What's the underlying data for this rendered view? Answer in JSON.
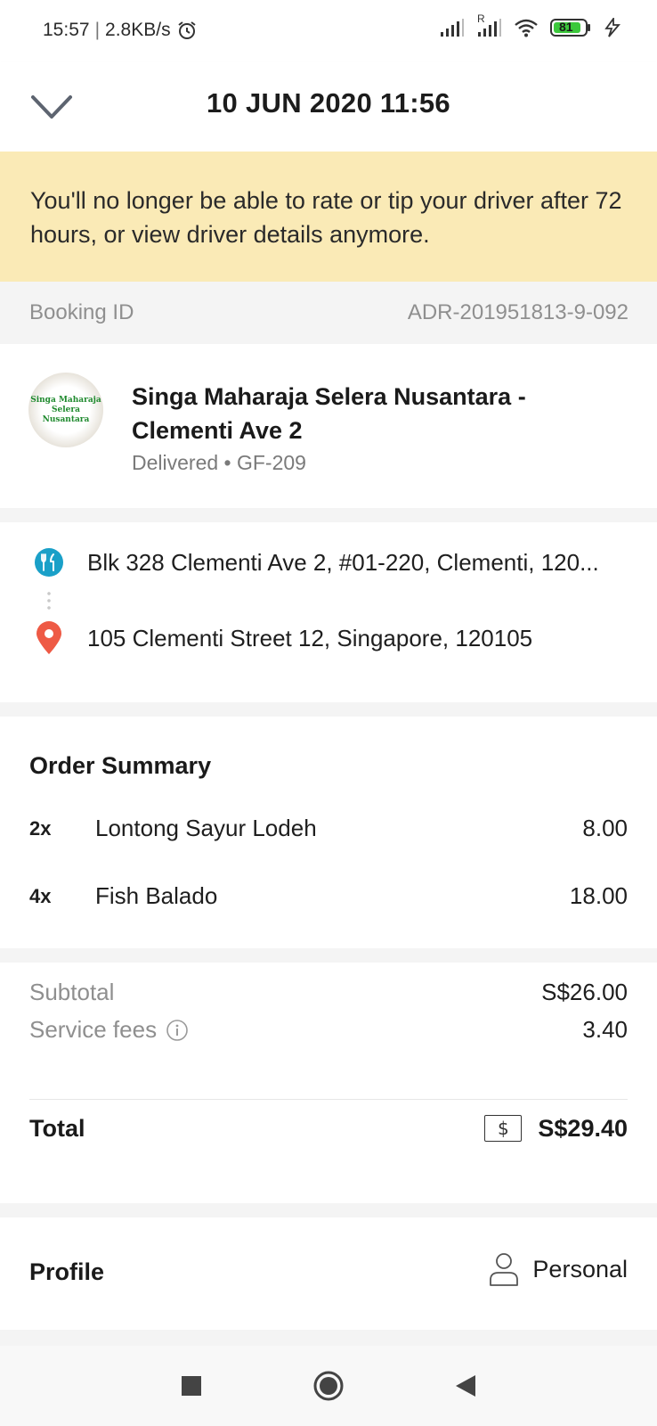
{
  "status_bar": {
    "time": "15:57",
    "separator": "|",
    "network_speed": "2.8KB/s",
    "alarm_icon": "alarm-clock-icon",
    "roaming_label": "R",
    "battery": "81"
  },
  "header": {
    "title": "10 JUN 2020 11:56",
    "back_icon": "chevron-down-icon"
  },
  "notice": {
    "text": "You'll no longer be able to rate or tip your driver after 72 hours, or view driver details anymore."
  },
  "booking": {
    "label": "Booking ID",
    "value": "ADR-201951813-9-092"
  },
  "merchant": {
    "logo_text": [
      "Singa Maharaja",
      "Selera",
      "Nusantara"
    ],
    "name": "Singa Maharaja Selera Nusantara - Clementi Ave 2",
    "status": "Delivered • GF-209"
  },
  "addresses": {
    "pickup": "Blk 328 Clementi Ave 2, #01-220, Clementi, 120...",
    "dropoff": "105 Clementi Street 12, Singapore, 120105"
  },
  "order": {
    "title": "Order Summary",
    "items": [
      {
        "qty": "2x",
        "name": "Lontong Sayur Lodeh",
        "price": "8.00"
      },
      {
        "qty": "4x",
        "name": "Fish Balado",
        "price": "18.00"
      }
    ]
  },
  "totals": {
    "subtotal_label": "Subtotal",
    "subtotal_value": "S$26.00",
    "service_label": "Service fees",
    "service_value": "3.40",
    "total_label": "Total",
    "currency_symbol": "$",
    "total_value": "S$29.40"
  },
  "profile": {
    "label": "Profile",
    "value": "Personal"
  },
  "colors": {
    "notice_bg": "#faeab6",
    "pickup_icon": "#1aa0c8",
    "dropoff_icon": "#ee5a45",
    "battery_green": "#3cc83c"
  }
}
